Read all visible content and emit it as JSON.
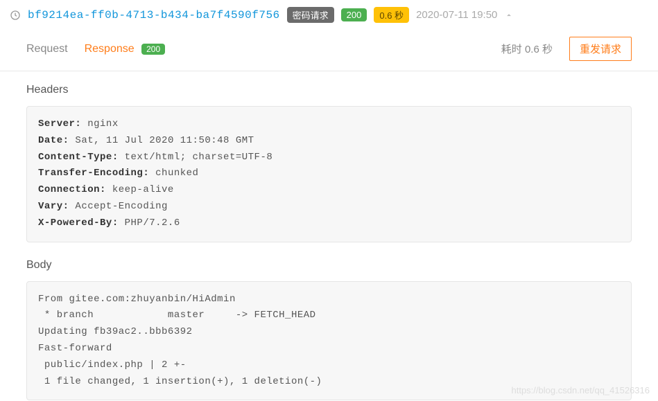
{
  "header": {
    "requestId": "bf9214ea-ff0b-4713-b434-ba7f4590f756",
    "typeBadge": "密码请求",
    "statusBadge": "200",
    "durationBadge": "0.6 秒",
    "timestamp": "2020-07-11 19:50"
  },
  "tabs": {
    "request": "Request",
    "response": "Response",
    "responseBadge": "200",
    "durationLabel": "耗时 0.6 秒",
    "resendButton": "重发请求"
  },
  "sections": {
    "headersTitle": "Headers",
    "bodyTitle": "Body"
  },
  "responseHeaders": [
    {
      "key": "Server",
      "value": "nginx"
    },
    {
      "key": "Date",
      "value": "Sat, 11 Jul 2020 11:50:48 GMT"
    },
    {
      "key": "Content-Type",
      "value": "text/html; charset=UTF-8"
    },
    {
      "key": "Transfer-Encoding",
      "value": "chunked"
    },
    {
      "key": "Connection",
      "value": "keep-alive"
    },
    {
      "key": "Vary",
      "value": "Accept-Encoding"
    },
    {
      "key": "X-Powered-By",
      "value": "PHP/7.2.6"
    }
  ],
  "responseBody": "From gitee.com:zhuyanbin/HiAdmin\n * branch            master     -> FETCH_HEAD\nUpdating fb39ac2..bbb6392\nFast-forward\n public/index.php | 2 +-\n 1 file changed, 1 insertion(+), 1 deletion(-)",
  "watermark": "https://blog.csdn.net/qq_41526316"
}
